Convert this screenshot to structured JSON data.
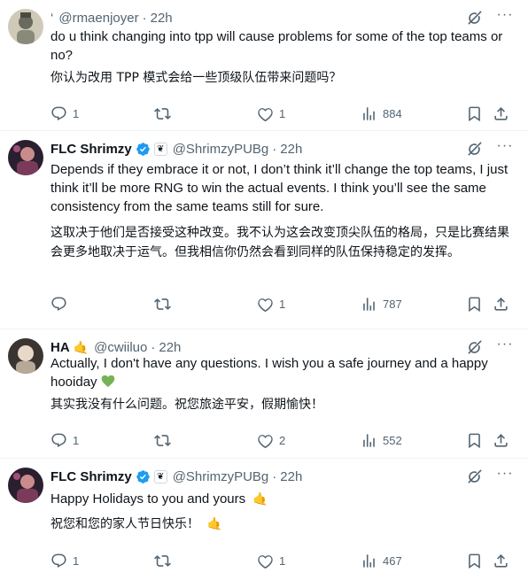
{
  "tweets": [
    {
      "name": "",
      "handle_prefix": "‘",
      "handle": "@rmaenjoyer",
      "dot": "·",
      "time": "22h",
      "text_en": "do u think changing into tpp will cause problems for some of the top teams or no?",
      "text_zh": "你认为改用 TPP 模式会给一些顶级队伍带来问题吗？",
      "replies": "1",
      "retweets": "",
      "likes": "1",
      "views": "884"
    },
    {
      "name": "FLC Shrimzy",
      "handle": "@ShrimzyPUBg",
      "dot": "·",
      "time": "22h",
      "affiliate_glyph": "❦",
      "text_en": "Depends if they embrace it or not, I don’t think it’ll change the top teams, I just think it’ll be more RNG to win the actual events. I think you’ll see the same consistency from the same teams still for sure.",
      "text_zh": "这取决于他们是否接受这种改变。我不认为这会改变顶尖队伍的格局，只是比赛结果会更多地取决于运气。但我相信你仍然会看到同样的队伍保持稳定的发挥。",
      "replies": "",
      "retweets": "",
      "likes": "1",
      "views": "787"
    },
    {
      "name": "HA",
      "name_emoji": "🤙",
      "handle": "@cwiiluo",
      "dot": "·",
      "time": "22h",
      "text_en": "Actually, I don't have any questions. I wish you a safe journey and a happy hooiday",
      "text_zh": "其实我没有什么问题。祝您旅途平安，假期愉快！",
      "replies": "1",
      "retweets": "",
      "likes": "2",
      "views": "552"
    },
    {
      "name": "FLC Shrimzy",
      "handle": "@ShrimzyPUBg",
      "dot": "·",
      "time": "22h",
      "affiliate_glyph": "❦",
      "text_en": "Happy Holidays to you and yours",
      "text_zh": "祝您和您的家人节日快乐！",
      "emoji": "🤙",
      "replies": "1",
      "retweets": "",
      "likes": "1",
      "views": "467"
    }
  ],
  "colors": {
    "text": "#0f1419",
    "muted": "#536471",
    "verified": "#1d9bf0",
    "divider": "#eff3f4",
    "heart_green": "#77b255"
  },
  "icons": [
    "more-icon",
    "grok-icon",
    "reply-icon",
    "retweet-icon",
    "like-icon",
    "views-icon",
    "bookmark-icon",
    "share-icon",
    "verified-icon"
  ]
}
